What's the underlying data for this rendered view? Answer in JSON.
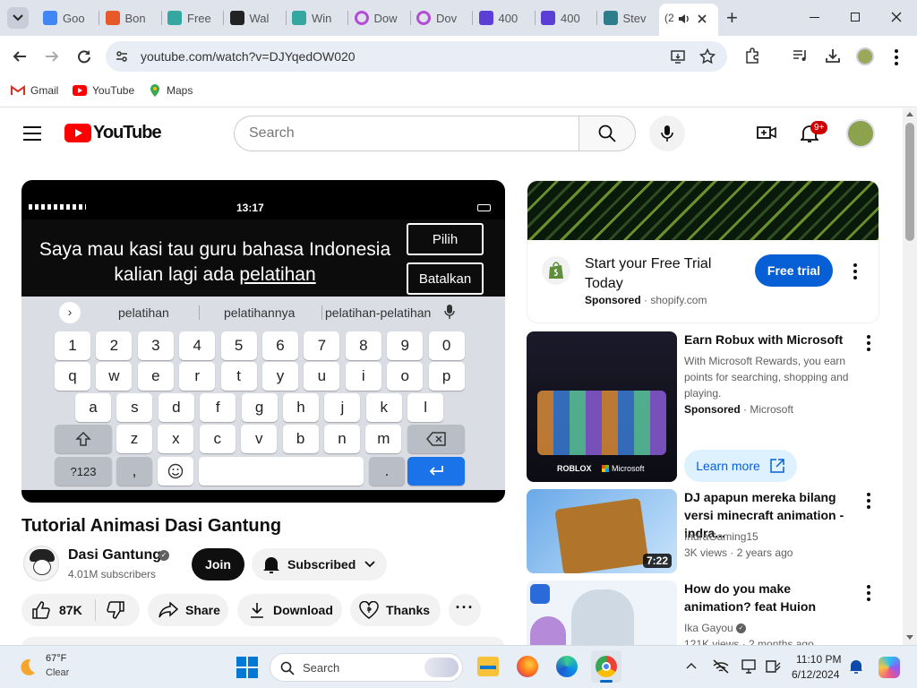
{
  "browser": {
    "tabs": [
      {
        "label": "Goo",
        "icon": "google-icon"
      },
      {
        "label": "Bon",
        "icon": "rainbow-icon"
      },
      {
        "label": "Free",
        "icon": "doc-icon"
      },
      {
        "label": "Wal",
        "icon": "star-icon"
      },
      {
        "label": "Win",
        "icon": "doc-icon"
      },
      {
        "label": "Dow",
        "icon": "ring-icon"
      },
      {
        "label": "Dov",
        "icon": "ring-icon"
      },
      {
        "label": "400",
        "icon": "image-icon"
      },
      {
        "label": "400",
        "icon": "image-icon"
      },
      {
        "label": "Stev",
        "icon": "steam-icon"
      }
    ],
    "active_tab_label": "(2",
    "new_tab": "+",
    "url": "youtube.com/watch?v=DJYqedOW020",
    "bookmarks": [
      {
        "label": "Gmail",
        "icon": "gmail-icon"
      },
      {
        "label": "YouTube",
        "icon": "youtube-icon"
      },
      {
        "label": "Maps",
        "icon": "maps-icon"
      }
    ]
  },
  "youtube": {
    "logo_text": "YouTube",
    "search_placeholder": "Search",
    "notif_badge": "9+"
  },
  "video": {
    "status_time": "13:17",
    "caption_line1": "Saya mau kasi tau guru bahasa Indonesia",
    "caption_line2_prefix": "kalian lagi ada ",
    "caption_line2_link": "pelatihan",
    "btn_pilih": "Pilih",
    "btn_batalkan": "Batalkan",
    "suggestions": [
      "pelatihan",
      "pelatihannya",
      "pelatihan-pelatihan"
    ],
    "keys_row1": [
      "1",
      "2",
      "3",
      "4",
      "5",
      "6",
      "7",
      "8",
      "9",
      "0"
    ],
    "keys_row2": [
      "q",
      "w",
      "e",
      "r",
      "t",
      "y",
      "u",
      "i",
      "o",
      "p"
    ],
    "keys_row3": [
      "a",
      "s",
      "d",
      "f",
      "g",
      "h",
      "j",
      "k",
      "l"
    ],
    "keys_row4": [
      "z",
      "x",
      "c",
      "v",
      "b",
      "n",
      "m"
    ],
    "key_sym": "?123",
    "key_comma": ",",
    "key_period": "."
  },
  "watch": {
    "title": "Tutorial Animasi Dasi Gantung",
    "channel": "Dasi Gantung",
    "subscribers": "4.01M subscribers",
    "join": "Join",
    "subscribed": "Subscribed",
    "likes": "87K",
    "share": "Share",
    "download": "Download",
    "thanks": "Thanks"
  },
  "sidebar": {
    "ad1": {
      "title": "Start your Free Trial Today",
      "sponsored": "Sponsored",
      "domain": "shopify.com",
      "cta": "Free trial"
    },
    "ad2": {
      "title": "Earn Robux with Microsoft",
      "desc": "With Microsoft Rewards, you earn points for searching, shopping and playing.",
      "sponsored": "Sponsored",
      "advertiser": "Microsoft",
      "cta": "Learn more",
      "thumb_text1": "ROBLOX",
      "thumb_text2": "Microsoft"
    },
    "rec1": {
      "title": "DJ apapun mereka bilang versi minecraft animation - indra...",
      "channel": "IndraGaming15",
      "views": "3K views",
      "age": "2 years ago",
      "duration": "7:22"
    },
    "rec2": {
      "title": "How do you make animation? feat Huion",
      "channel": "Ika Gayou",
      "views": "121K views",
      "age": "2 months ago"
    }
  },
  "taskbar": {
    "weather_temp": "67°F",
    "weather_desc": "Clear",
    "search_label": "Search",
    "time": "11:10 PM",
    "date": "6/12/2024"
  }
}
